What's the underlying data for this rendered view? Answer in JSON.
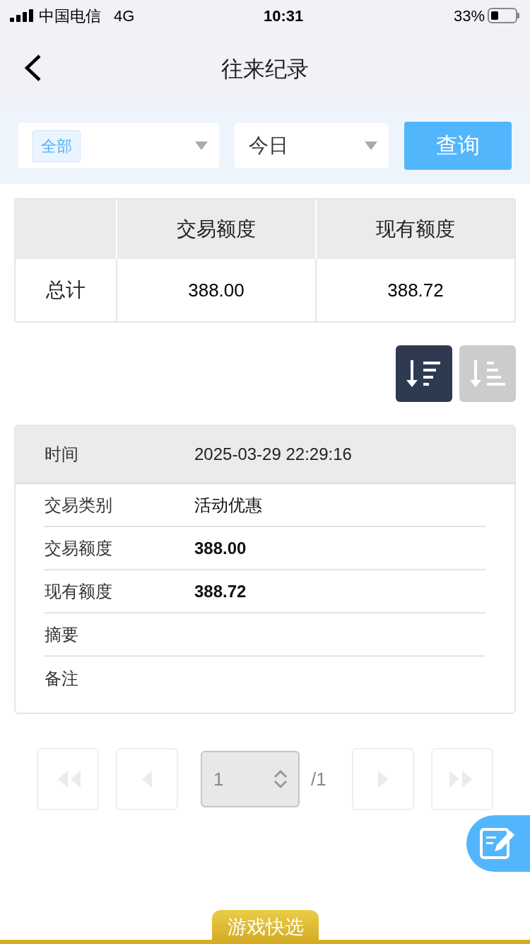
{
  "status_bar": {
    "carrier": "中国电信",
    "network": "4G",
    "time": "10:31",
    "battery": "33%"
  },
  "header": {
    "title": "往来纪录"
  },
  "filters": [
    {
      "kind": "tag",
      "value": "全部"
    },
    {
      "kind": "text",
      "value": "今日"
    }
  ],
  "query_button": "查询",
  "summary": {
    "columns": [
      "交易额度",
      "现有额度"
    ],
    "rows": [
      {
        "label": "总计",
        "cells": [
          "388.00",
          "388.72"
        ]
      }
    ]
  },
  "sort_buttons": [
    {
      "kind": "descending",
      "selected": true
    },
    {
      "kind": "ascending",
      "selected": false
    }
  ],
  "record": {
    "header": {
      "label": "时间",
      "value": "2025-03-29 22:29:16"
    },
    "rows": [
      {
        "label": "交易类别",
        "value": "活动优惠",
        "bold": false
      },
      {
        "label": "交易额度",
        "value": "388.00",
        "bold": true
      },
      {
        "label": "现有额度",
        "value": "388.72",
        "bold": true
      },
      {
        "label": "摘要"
      },
      {
        "label": "备注"
      }
    ]
  },
  "pager": {
    "buttons": [
      {
        "kind": "first",
        "disabled": true
      },
      {
        "kind": "prev",
        "disabled": true
      },
      {
        "kind": "next",
        "disabled": true
      },
      {
        "kind": "last",
        "disabled": true
      }
    ],
    "page": "1",
    "total": "/1"
  },
  "bottom_tab": "游戏快选"
}
